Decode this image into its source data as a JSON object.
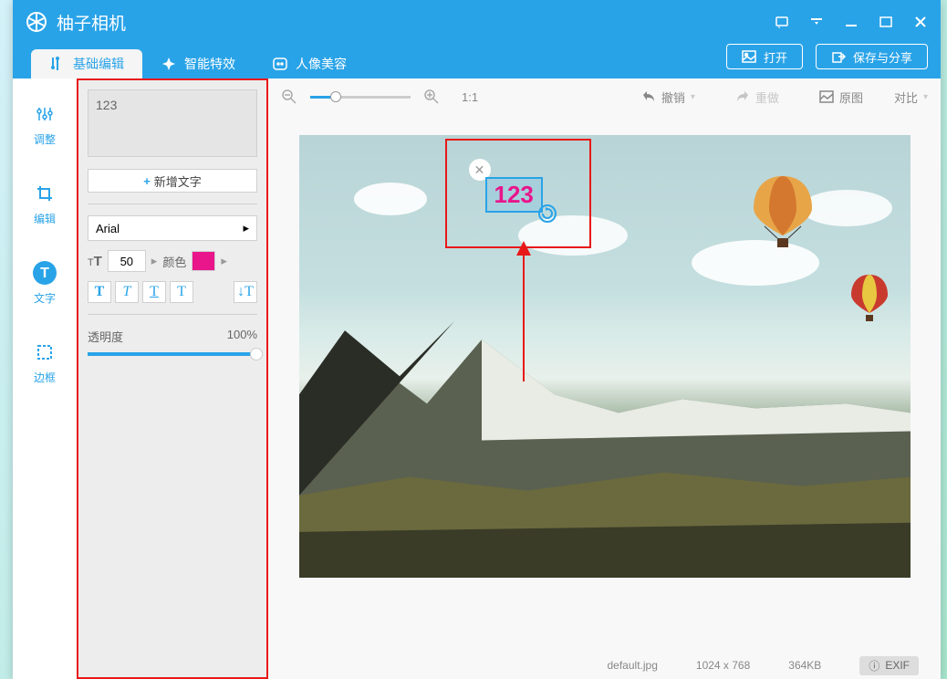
{
  "app": {
    "title": "柚子相机"
  },
  "tabs": [
    {
      "label": "基础编辑"
    },
    {
      "label": "智能特效"
    },
    {
      "label": "人像美容"
    }
  ],
  "topButtons": {
    "open": "打开",
    "save": "保存与分享"
  },
  "sidebar": [
    {
      "label": "调整"
    },
    {
      "label": "编辑"
    },
    {
      "label": "文字"
    },
    {
      "label": "边框"
    }
  ],
  "textPanel": {
    "textValue": "123",
    "addText": "新增文字",
    "fontName": "Arial",
    "size": "50",
    "colorLabel": "颜色",
    "colorHex": "#e8158b",
    "opacityLabel": "透明度",
    "opacityValue": "100%"
  },
  "toolbar": {
    "oneToOne": "1:1",
    "undo": "撤销",
    "redo": "重做",
    "original": "原图",
    "compare": "对比"
  },
  "overlayText": "123",
  "status": {
    "filename": "default.jpg",
    "dimensions": "1024 x 768",
    "filesize": "364KB",
    "exif": "EXIF"
  }
}
